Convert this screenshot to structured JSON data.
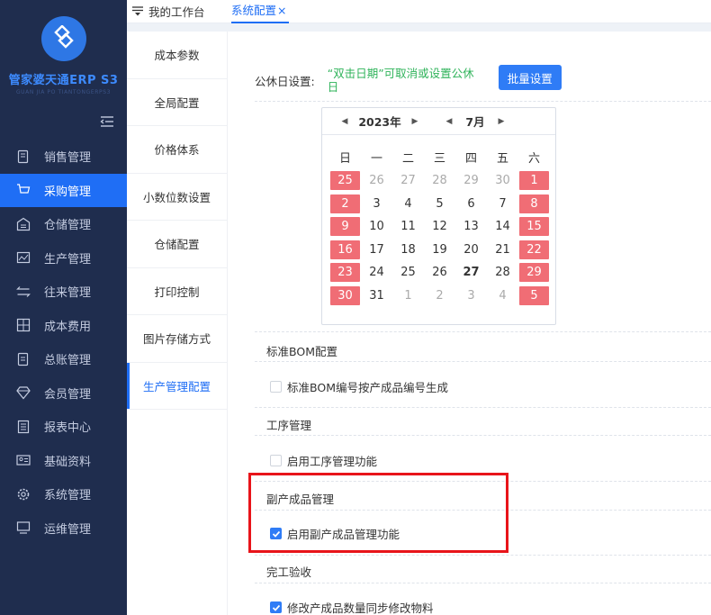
{
  "app": {
    "brand_name": "管家婆天通ERP S3",
    "brand_sub": "GUAN JIA PO TIANTONGERPS3"
  },
  "sidebar": {
    "items": [
      {
        "label": "销售管理",
        "icon": "sales-doc-icon",
        "active": false
      },
      {
        "label": "采购管理",
        "icon": "cart-icon",
        "active": true
      },
      {
        "label": "仓储管理",
        "icon": "warehouse-icon",
        "active": false
      },
      {
        "label": "生产管理",
        "icon": "production-icon",
        "active": false
      },
      {
        "label": "往来管理",
        "icon": "exchange-icon",
        "active": false
      },
      {
        "label": "成本费用",
        "icon": "calculator-icon",
        "active": false
      },
      {
        "label": "总账管理",
        "icon": "ledger-icon",
        "active": false
      },
      {
        "label": "会员管理",
        "icon": "diamond-icon",
        "active": false
      },
      {
        "label": "报表中心",
        "icon": "report-icon",
        "active": false
      },
      {
        "label": "基础资料",
        "icon": "id-card-icon",
        "active": false
      },
      {
        "label": "系统管理",
        "icon": "gear-icon",
        "active": false
      },
      {
        "label": "运维管理",
        "icon": "monitor-icon",
        "active": false
      }
    ]
  },
  "tabs": {
    "home": "我的工作台",
    "active": "系统配置",
    "close": "×"
  },
  "submenu": {
    "items": [
      "成本参数",
      "全局配置",
      "价格体系",
      "小数位数设置",
      "仓储配置",
      "打印控制",
      "图片存储方式",
      "生产管理配置"
    ],
    "active_index": 7
  },
  "holiday": {
    "label": "公休日设置:",
    "tip": "“双击日期”可取消或设置公休日",
    "batch_button": "批量设置"
  },
  "calendar": {
    "year": "2023年",
    "month": "7月",
    "weekdays": [
      "日",
      "一",
      "二",
      "三",
      "四",
      "五",
      "六"
    ],
    "weeks": [
      [
        {
          "d": "25",
          "o": true,
          "h": true
        },
        {
          "d": "26",
          "o": true
        },
        {
          "d": "27",
          "o": true
        },
        {
          "d": "28",
          "o": true
        },
        {
          "d": "29",
          "o": true
        },
        {
          "d": "30",
          "o": true
        },
        {
          "d": "1",
          "h": true
        }
      ],
      [
        {
          "d": "2",
          "h": true
        },
        {
          "d": "3"
        },
        {
          "d": "4"
        },
        {
          "d": "5"
        },
        {
          "d": "6"
        },
        {
          "d": "7"
        },
        {
          "d": "8",
          "h": true
        }
      ],
      [
        {
          "d": "9",
          "h": true
        },
        {
          "d": "10"
        },
        {
          "d": "11"
        },
        {
          "d": "12"
        },
        {
          "d": "13"
        },
        {
          "d": "14"
        },
        {
          "d": "15",
          "h": true
        }
      ],
      [
        {
          "d": "16",
          "h": true
        },
        {
          "d": "17"
        },
        {
          "d": "18"
        },
        {
          "d": "19"
        },
        {
          "d": "20"
        },
        {
          "d": "21"
        },
        {
          "d": "22",
          "h": true
        }
      ],
      [
        {
          "d": "23",
          "h": true
        },
        {
          "d": "24"
        },
        {
          "d": "25"
        },
        {
          "d": "26"
        },
        {
          "d": "27",
          "t": true
        },
        {
          "d": "28"
        },
        {
          "d": "29",
          "h": true
        }
      ],
      [
        {
          "d": "30",
          "h": true
        },
        {
          "d": "31"
        },
        {
          "d": "1",
          "o": true
        },
        {
          "d": "2",
          "o": true
        },
        {
          "d": "3",
          "o": true
        },
        {
          "d": "4",
          "o": true
        },
        {
          "d": "5",
          "o": true,
          "h": true
        }
      ]
    ]
  },
  "sections": {
    "bom": {
      "title": "标准BOM配置",
      "option": "标准BOM编号按产成品编号生成",
      "checked": false
    },
    "process": {
      "title": "工序管理",
      "option": "启用工序管理功能",
      "checked": false
    },
    "byproduct": {
      "title": "副产成品管理",
      "option": "启用副产成品管理功能",
      "checked": true
    },
    "acceptance": {
      "title": "完工验收",
      "option": "修改产成品数量同步修改物料",
      "checked": true
    }
  },
  "colors": {
    "sidebar_bg": "#1f2d4e",
    "accent": "#1f6ef5",
    "holiday": "#f06d75",
    "tip_green": "#2fb35a",
    "highlight_red": "#e8141a"
  }
}
